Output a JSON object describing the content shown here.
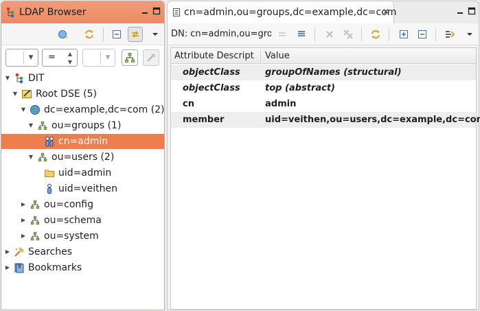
{
  "left_panel": {
    "title": "LDAP Browser",
    "filter": {
      "attribute_value": "",
      "operator_value": "=",
      "value_value": ""
    },
    "tree": [
      {
        "label": "DIT",
        "level": 0,
        "expanded": true,
        "icon": "dit-icon"
      },
      {
        "label": "Root DSE (5)",
        "level": 1,
        "expanded": true,
        "icon": "root-dse-icon"
      },
      {
        "label": "dc=example,dc=com (2)",
        "level": 2,
        "expanded": true,
        "icon": "globe-icon"
      },
      {
        "label": "ou=groups (1)",
        "level": 3,
        "expanded": true,
        "icon": "org-unit-icon"
      },
      {
        "label": "cn=admin",
        "level": 4,
        "expanded": false,
        "icon": "group-icon",
        "selected": true
      },
      {
        "label": "ou=users (2)",
        "level": 3,
        "expanded": true,
        "icon": "org-unit-icon"
      },
      {
        "label": "uid=admin",
        "level": 4,
        "expanded": false,
        "icon": "folder-icon"
      },
      {
        "label": "uid=veithen",
        "level": 4,
        "expanded": false,
        "icon": "person-icon"
      },
      {
        "label": "ou=config",
        "level": 2,
        "expanded": false,
        "icon": "org-unit-icon"
      },
      {
        "label": "ou=schema",
        "level": 2,
        "expanded": false,
        "icon": "org-unit-icon"
      },
      {
        "label": "ou=system",
        "level": 2,
        "expanded": false,
        "icon": "org-unit-icon"
      },
      {
        "label": "Searches",
        "level": 0,
        "expanded": false,
        "icon": "searches-icon"
      },
      {
        "label": "Bookmarks",
        "level": 0,
        "expanded": false,
        "icon": "bookmarks-icon"
      }
    ]
  },
  "editor": {
    "tab_title": "cn=admin,ou=groups,dc=example,dc=com",
    "dn_label": "DN: cn=admin,ou=groups,dc=example,dc=com",
    "columns": [
      "Attribute Descript",
      "Value"
    ],
    "rows": [
      {
        "attribute": "objectClass",
        "value": "groupOfNames (structural)",
        "italic": true
      },
      {
        "attribute": "objectClass",
        "value": "top (abstract)",
        "italic": true
      },
      {
        "attribute": "cn",
        "value": "admin",
        "italic": false
      },
      {
        "attribute": "member",
        "value": "uid=veithen,ou=users,dc=example,dc=com",
        "italic": false
      }
    ]
  },
  "colors": {
    "active_tab": "#ef8a62",
    "selection": "#ef7e4e",
    "alt_row": "#eeeeee"
  }
}
